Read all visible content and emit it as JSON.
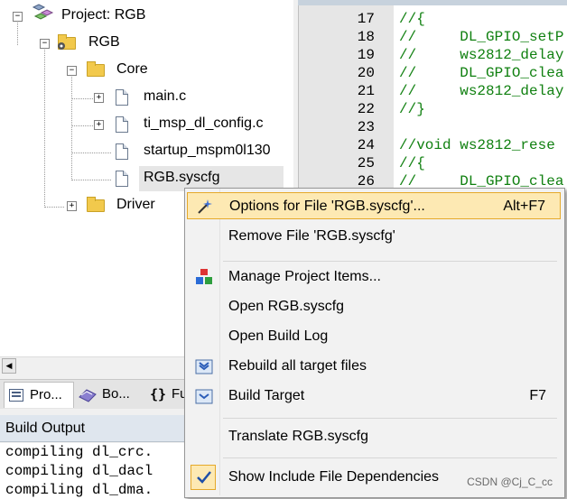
{
  "tree": {
    "project_label": "Project: RGB",
    "target_label": "RGB",
    "group_core": "Core",
    "files": [
      "main.c",
      "ti_msp_dl_config.c",
      "startup_mspm0l130",
      "RGB.syscfg"
    ],
    "group_driver": "Driver"
  },
  "tabs": [
    {
      "label": "Pro...",
      "icon": "project-icon"
    },
    {
      "label": "Bo...",
      "icon": "books-icon"
    },
    {
      "label": "Fu",
      "icon": "functions-icon"
    }
  ],
  "build_output": {
    "title": "Build Output",
    "lines": [
      "compiling dl_crc.",
      "compiling dl_dacl",
      "compiling dl_dma."
    ]
  },
  "editor": {
    "lines": [
      {
        "num": "17",
        "code": "//{"
      },
      {
        "num": "18",
        "code": "//     DL_GPIO_setP"
      },
      {
        "num": "19",
        "code": "//     ws2812_delay"
      },
      {
        "num": "20",
        "code": "//     DL_GPIO_clea"
      },
      {
        "num": "21",
        "code": "//     ws2812_delay"
      },
      {
        "num": "22",
        "code": "//}"
      },
      {
        "num": "23",
        "code": ""
      },
      {
        "num": "24",
        "code": "//void ws2812_rese"
      },
      {
        "num": "25",
        "code": "//{"
      },
      {
        "num": "26",
        "code": "//     DL_GPIO_clea"
      }
    ]
  },
  "menu": {
    "options_label": "Options for File 'RGB.syscfg'...",
    "options_shortcut": "Alt+F7",
    "remove_label": "Remove File 'RGB.syscfg'",
    "manage_label": "Manage Project Items...",
    "open_label": "Open RGB.syscfg",
    "open_log_label": "Open Build Log",
    "rebuild_label": "Rebuild all target files",
    "build_label": "Build Target",
    "build_shortcut": "F7",
    "translate_label": "Translate RGB.syscfg",
    "show_deps_label": "Show Include File Dependencies"
  },
  "watermark": "CSDN @Cj_C_cc",
  "colors": {
    "menu_highlight": "#fde9b3",
    "menu_highlight_border": "#e5a92a",
    "code_comment": "#108010"
  }
}
